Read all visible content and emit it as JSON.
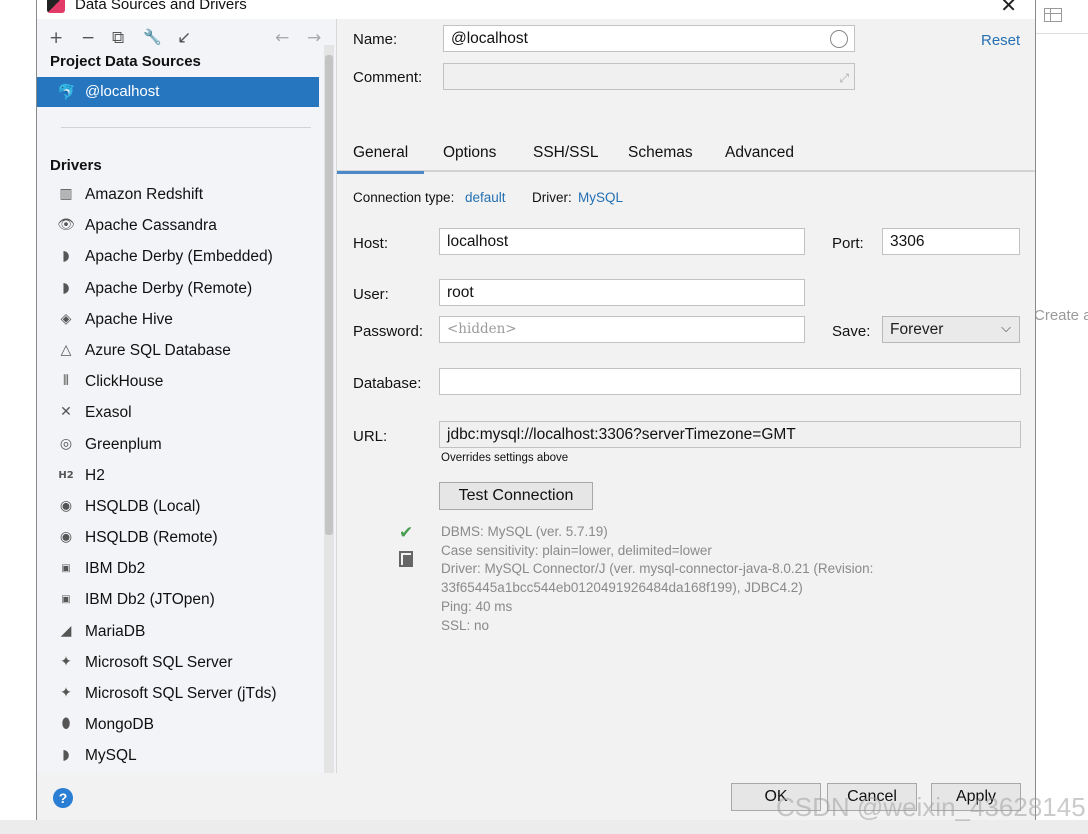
{
  "window": {
    "title": "Data Sources and Drivers"
  },
  "toolbar": {
    "add": "+",
    "remove": "−",
    "copy": "⧉",
    "settings": "🔧",
    "import": "↙",
    "back": "←",
    "forward": "→"
  },
  "sidebar": {
    "project_heading": "Project Data Sources",
    "selected_source": "@localhost",
    "drivers_heading": "Drivers",
    "drivers": [
      {
        "label": "Amazon Redshift",
        "icon": "▥"
      },
      {
        "label": "Apache Cassandra",
        "icon": "👁"
      },
      {
        "label": "Apache Derby (Embedded)",
        "icon": "◗"
      },
      {
        "label": "Apache Derby (Remote)",
        "icon": "◗"
      },
      {
        "label": "Apache Hive",
        "icon": "◈"
      },
      {
        "label": "Azure SQL Database",
        "icon": "△"
      },
      {
        "label": "ClickHouse",
        "icon": "⦀"
      },
      {
        "label": "Exasol",
        "icon": "✕"
      },
      {
        "label": "Greenplum",
        "icon": "◎"
      },
      {
        "label": "H2",
        "icon": "H2"
      },
      {
        "label": "HSQLDB (Local)",
        "icon": "◉"
      },
      {
        "label": "HSQLDB (Remote)",
        "icon": "◉"
      },
      {
        "label": "IBM Db2",
        "icon": "▣"
      },
      {
        "label": "IBM Db2 (JTOpen)",
        "icon": "▣"
      },
      {
        "label": "MariaDB",
        "icon": "◢"
      },
      {
        "label": "Microsoft SQL Server",
        "icon": "✦"
      },
      {
        "label": "Microsoft SQL Server (jTds)",
        "icon": "✦"
      },
      {
        "label": "MongoDB",
        "icon": "⬮"
      },
      {
        "label": "MySQL",
        "icon": "◗"
      }
    ]
  },
  "form": {
    "name_label": "Name:",
    "name_value": "@localhost",
    "reset": "Reset",
    "comment_label": "Comment:",
    "comment_value": "",
    "tabs": [
      "General",
      "Options",
      "SSH/SSL",
      "Schemas",
      "Advanced"
    ],
    "connection_type_label": "Connection type:",
    "connection_type_value": "default",
    "driver_label": "Driver:",
    "driver_value": "MySQL",
    "host_label": "Host:",
    "host_value": "localhost",
    "port_label": "Port:",
    "port_value": "3306",
    "user_label": "User:",
    "user_value": "root",
    "password_label": "Password:",
    "password_placeholder": "<hidden>",
    "save_label": "Save:",
    "save_value": "Forever",
    "database_label": "Database:",
    "database_value": "",
    "url_label": "URL:",
    "url_value": "jdbc:mysql://localhost:3306?serverTimezone=GMT",
    "url_hint": "Overrides settings above",
    "test_connection": "Test Connection",
    "info_lines": [
      "DBMS: MySQL (ver. 5.7.19)",
      "Case sensitivity: plain=lower, delimited=lower",
      "Driver: MySQL Connector/J (ver. mysql-connector-java-8.0.21 (Revision:",
      "33f65445a1bcc544eb0120491926484da168f199), JDBC4.2)",
      "Ping: 40 ms",
      "SSL: no"
    ]
  },
  "footer": {
    "ok": "OK",
    "cancel": "Cancel",
    "apply": "Apply",
    "help": "?"
  },
  "background": {
    "create_text": "Create a"
  },
  "watermark": "CSDN @weixin_43628145",
  "colors": {
    "accent": "#2675bf",
    "link": "#2470b3",
    "success": "#4a9e52"
  }
}
